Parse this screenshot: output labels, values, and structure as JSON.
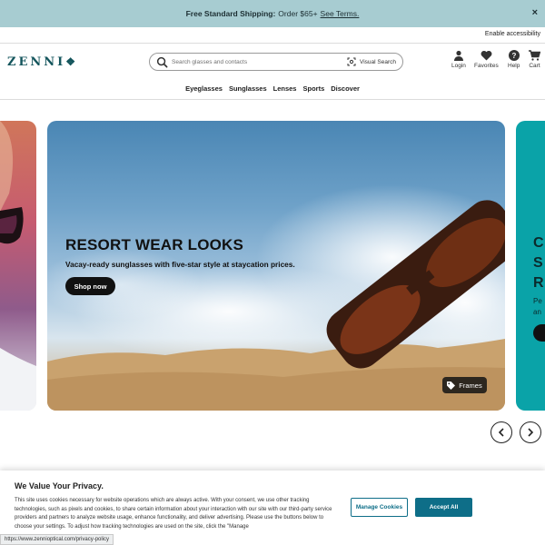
{
  "promo": {
    "bold": "Free Standard Shipping:",
    "text": "Order $65+",
    "link": "See Terms.",
    "close": "×"
  },
  "accessibility": "Enable accessibility",
  "header": {
    "logo": "ZENNI",
    "search_placeholder": "Search glasses and contacts",
    "visual_search": "Visual Search",
    "icons": [
      {
        "name": "user-icon",
        "label": "Login"
      },
      {
        "name": "heart-icon",
        "label": "Favorites"
      },
      {
        "name": "help-icon",
        "label": "Help"
      },
      {
        "name": "cart-icon",
        "label": "Cart"
      }
    ]
  },
  "nav": [
    "Eyeglasses",
    "Sunglasses",
    "Lenses",
    "Sports",
    "Discover"
  ],
  "hero": {
    "title": "RESORT WEAR LOOKS",
    "subtitle": "Vacay-ready sunglasses with five-star style at staycation prices.",
    "button": "Shop now",
    "tag": "Frames"
  },
  "next_slide": {
    "lines": [
      "C",
      "S",
      "R"
    ],
    "sub": [
      "Pe",
      "an"
    ]
  },
  "cookie": {
    "title": "We Value Your Privacy.",
    "body": "This site uses cookies necessary for website operations which are always active. With your consent, we use other tracking technologies, such as pixels and cookies, to share certain information about your interaction with our site with our third-party service providers and partners to analyze website usage, enhance functionality, and deliver advertising. Please use the buttons below to choose your settings. To adjust how tracking technologies are used on the site, click the \"Manage",
    "manage": "Manage Cookies",
    "accept": "Accept All"
  },
  "status_url": "https://www.zennioptical.com/privacy-policy",
  "colors": {
    "brand": "#14555c",
    "promo_bg": "#a7ccd1",
    "accent": "#0e6e88"
  }
}
